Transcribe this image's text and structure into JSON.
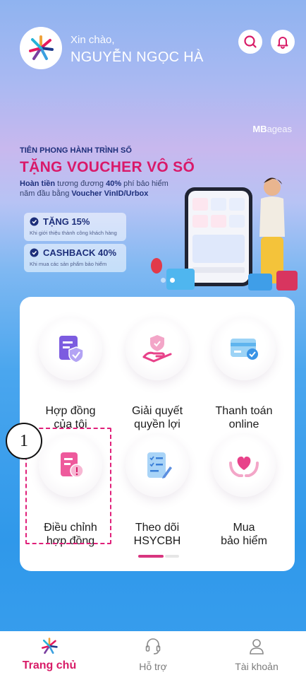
{
  "header": {
    "greeting": "Xin chào,",
    "user_name": "NGUYỄN NGỌC HÀ",
    "search_icon": "search-icon",
    "notification_icon": "bell-icon"
  },
  "banner": {
    "brand_strong": "MB",
    "brand_light": "ageas",
    "pre_title": "TIÊN PHONG HÀNH TRÌNH SỐ",
    "title": "TẶNG VOUCHER VÔ SỐ",
    "desc_1": "Hoàn tiền",
    "desc_2": " tương đương ",
    "desc_3": "40%",
    "desc_4": " phí bảo hiểm năm đầu bằng ",
    "desc_5": "Voucher VinID/Urbox",
    "offer_1_title": "TẶNG 15%",
    "offer_1_sub": "Khi giới thiệu thành công khách hàng",
    "offer_2_title": "CASHBACK 40%",
    "offer_2_sub": "Khi mua các sản phẩm bảo hiểm"
  },
  "menu": {
    "items": [
      {
        "label_1": "Hợp đồng",
        "label_2": "của tôi",
        "icon": "contract-shield-icon"
      },
      {
        "label_1": "Giải quyết",
        "label_2": "quyền lợi",
        "icon": "hand-shield-icon"
      },
      {
        "label_1": "Thanh toán",
        "label_2": "online",
        "icon": "card-check-icon"
      },
      {
        "label_1": "Điều chỉnh",
        "label_2": "hợp đồng",
        "icon": "document-adjust-icon"
      },
      {
        "label_1": "Theo dõi",
        "label_2": "HSYCBH",
        "icon": "checklist-pen-icon"
      },
      {
        "label_1": "Mua",
        "label_2": "bảo hiểm",
        "icon": "hands-heart-icon"
      }
    ]
  },
  "annotation": {
    "number": "1"
  },
  "bottom_nav": {
    "home": "Trang chủ",
    "support": "Hỗ trợ",
    "account": "Tài khoản"
  },
  "colors": {
    "accent": "#d81b67",
    "highlight": "#e0207a",
    "banner_title": "#d9196a",
    "navy": "#1d2f7a"
  }
}
